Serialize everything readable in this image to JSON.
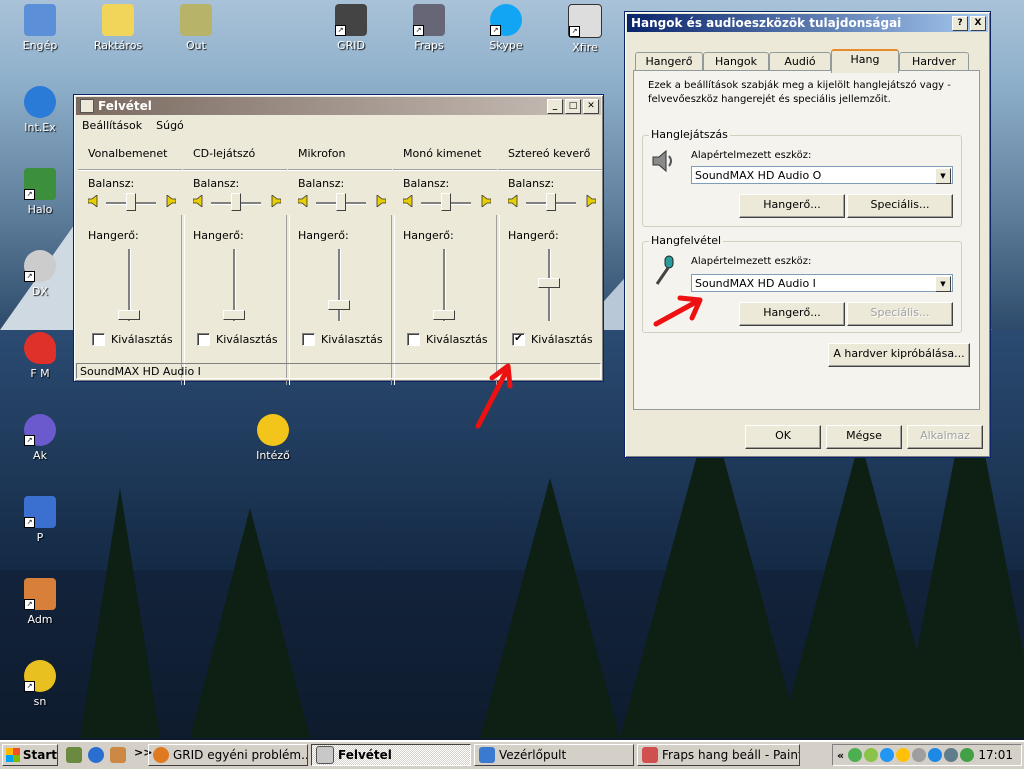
{
  "desktop": {
    "icons": [
      {
        "label": "Engép",
        "color": "#5b8fd8"
      },
      {
        "label": "Raktáros",
        "color": "#f1d45a"
      },
      {
        "label": "Out",
        "color": "#b7b46a"
      },
      {
        "label": "GRID",
        "color": "#444444"
      },
      {
        "label": "Fraps",
        "color": "#666677"
      },
      {
        "label": "Skype",
        "color": "#12a5f4"
      },
      {
        "label": "Xfire",
        "color": "#dddddd"
      },
      {
        "label": "Int.Ex",
        "color": "#2a7ad8"
      },
      {
        "label": "Halo",
        "color": "#3c8f3c"
      },
      {
        "label": "DX",
        "color": "#cccccc"
      },
      {
        "label": "F M",
        "color": "#e0302a"
      },
      {
        "label": "Ak",
        "color": "#6a5acd"
      },
      {
        "label": "Intéző",
        "color": "#f3c51a"
      },
      {
        "label": "P",
        "color": "#3b6fd0"
      },
      {
        "label": "Adm",
        "color": "#d8803a"
      },
      {
        "label": "sn",
        "color": "#e8c020"
      }
    ]
  },
  "mixer": {
    "title": "Felvétel",
    "menu": [
      "Beállítások",
      "Súgó"
    ],
    "balance_label": "Balansz:",
    "volume_label": "Hangerő:",
    "select_label": "Kiválasztás",
    "channels": [
      {
        "name": "Vonalbemenet",
        "volume": 0.05,
        "selected": false
      },
      {
        "name": "CD-lejátszó",
        "volume": 0.05,
        "selected": false
      },
      {
        "name": "Mikrofon",
        "volume": 0.2,
        "selected": false
      },
      {
        "name": "Monó kimenet",
        "volume": 0.05,
        "selected": false
      },
      {
        "name": "Sztereó keverő",
        "volume": 0.55,
        "selected": true,
        "check_mark": "✔"
      }
    ],
    "status": "SoundMAX HD Audio I"
  },
  "props": {
    "title": "Hangok és audioeszközök tulajdonságai",
    "help_btn": "?",
    "close_btn": "X",
    "tabs": [
      "Hangerő",
      "Hangok",
      "Audió",
      "Hang",
      "Hardver"
    ],
    "active_tab": "Hang",
    "description": "Ezek a beállítások szabják meg a kijelölt hanglejátszó vagy -felvevőeszköz hangerejét és speciális jellemzőit.",
    "playback": {
      "legend": "Hanglejátszás",
      "default_label": "Alapértelmezett eszköz:",
      "device": "SoundMAX HD Audio O",
      "volume_btn": "Hangerő...",
      "advanced_btn": "Speciális..."
    },
    "recording": {
      "legend": "Hangfelvétel",
      "default_label": "Alapértelmezett eszköz:",
      "device": "SoundMAX HD Audio I",
      "volume_btn": "Hangerő...",
      "advanced_btn": "Speciális..."
    },
    "test_btn": "A hardver kipróbálása...",
    "ok_btn": "OK",
    "cancel_btn": "Mégse",
    "apply_btn": "Alkalmaz"
  },
  "taskbar": {
    "start": "Start",
    "quick": ">>",
    "tasks": [
      {
        "label": "GRID egyéni problém...",
        "color": "#e07a20"
      },
      {
        "label": "Felvétel",
        "color": "#c8c8c8"
      },
      {
        "label": "Vezérlőpult",
        "color": "#3a7ad0"
      },
      {
        "label": "Fraps hang beáll - Paint",
        "color": "#d05050"
      }
    ],
    "tray_expand": "«",
    "clock": "17:01"
  }
}
